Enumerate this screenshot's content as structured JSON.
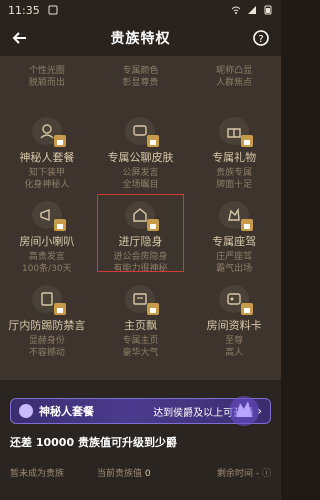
{
  "status": {
    "time": "11:35"
  },
  "toolbar": {
    "title": "贵族特权"
  },
  "grid_items": [
    {
      "name": "",
      "desc1": "个性光圈",
      "desc2": "脱颖而出"
    },
    {
      "name": "",
      "desc1": "专属颜色",
      "desc2": "彰显尊贵"
    },
    {
      "name": "",
      "desc1": "昵称凸显",
      "desc2": "人群焦点"
    },
    {
      "name": "神秘人套餐",
      "desc1": "知下装甲",
      "desc2": "化身神秘人",
      "icon": "mystery-icon"
    },
    {
      "name": "专属公聊皮肤",
      "desc1": "公屏发言",
      "desc2": "全场瞩目",
      "icon": "chat-skin-icon"
    },
    {
      "name": "专属礼物",
      "desc1": "贵族专属",
      "desc2": "牌面十足",
      "icon": "gift-icon"
    },
    {
      "name": "房间小喇叭",
      "desc1": "高贵发言",
      "desc2": "100条/30天",
      "icon": "megaphone-icon"
    },
    {
      "name": "进厅隐身",
      "desc1": "进公会房隐身",
      "desc2": "有能力很神秘",
      "icon": "hide-icon"
    },
    {
      "name": "专属座驾",
      "desc1": "庄严座驾",
      "desc2": "霸气出场",
      "icon": "mount-icon"
    },
    {
      "name": "厅内防踢防禁言",
      "desc1": "显赫身份",
      "desc2": "不容撼动",
      "icon": "protect-icon"
    },
    {
      "name": "主页飘",
      "desc1": "专属主页",
      "desc2": "豪华大气",
      "icon": "homepage-icon"
    },
    {
      "name": "房间资料卡",
      "desc1": "至尊",
      "desc2": "高人",
      "icon": "card-icon"
    }
  ],
  "banner": {
    "left": "神秘人套餐",
    "right": "达到侯爵及以上可开通"
  },
  "progress": {
    "prefix": "还差 ",
    "num": "10000",
    "suffix": " 贵族值可升级到少爵"
  },
  "info": {
    "status_label": "暂未成为贵族",
    "current_label": "当前贵族值",
    "current_value": "0",
    "remaining_label": "剩余时间 -"
  },
  "colors": {
    "accent_red": "#d23a3a",
    "banner_purple": "#4b3b8e",
    "gold": "#c79b4a"
  }
}
